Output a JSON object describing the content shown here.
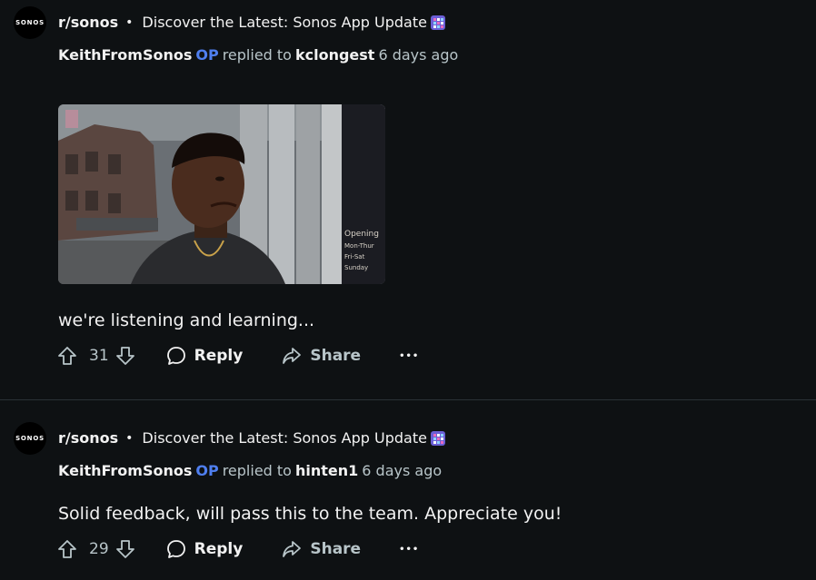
{
  "comments": [
    {
      "avatar_text": "SONOS",
      "subreddit": "r/sonos",
      "separator": "•",
      "post_title": "Discover the Latest: Sonos App Update",
      "author": "KeithFromSonos",
      "op_badge": "OP",
      "replied_to_label": "replied to",
      "replied_to_user": "kclongest",
      "age": "6 days ago",
      "body": "we're listening and learning...",
      "votes": "31",
      "reply_label": "Reply",
      "share_label": "Share",
      "more_label": "•••",
      "gif_sign_lines": [
        "Opening",
        "Mon-Thur",
        "Fri-Sat",
        "Sunday"
      ]
    },
    {
      "avatar_text": "SONOS",
      "subreddit": "r/sonos",
      "separator": "•",
      "post_title": "Discover the Latest: Sonos App Update",
      "author": "KeithFromSonos",
      "op_badge": "OP",
      "replied_to_label": "replied to",
      "replied_to_user": "hinten1",
      "age": "6 days ago",
      "body": "Solid feedback, will pass this to the team. Appreciate you!",
      "votes": "29",
      "reply_label": "Reply",
      "share_label": "Share",
      "more_label": "•••"
    }
  ],
  "colors": {
    "background": "#0e1113",
    "op_badge": "#4f7ff0",
    "muted_text": "#b8c5c9",
    "divider": "#2a3236"
  },
  "icons": [
    "upvote-icon",
    "downvote-icon",
    "comment-bubble-icon",
    "share-arrow-icon",
    "more-options-icon",
    "update-sparkle-emoji"
  ]
}
